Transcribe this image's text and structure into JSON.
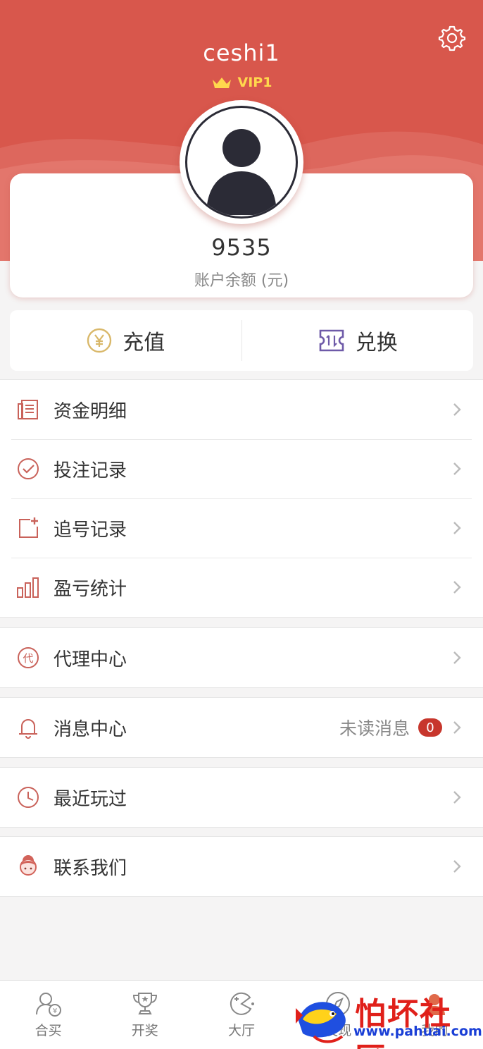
{
  "profile": {
    "username": "ceshi1",
    "vip_level": "VIP1",
    "balance": "9535",
    "balance_label": "账户余额 (元)"
  },
  "actions": {
    "recharge": "充值",
    "exchange": "兑换"
  },
  "menu": {
    "group1": [
      {
        "label": "资金明细",
        "icon": "document-list-icon"
      },
      {
        "label": "投注记录",
        "icon": "check-circle-icon"
      },
      {
        "label": "追号记录",
        "icon": "add-square-icon"
      },
      {
        "label": "盈亏统计",
        "icon": "bar-chart-icon"
      }
    ],
    "agent": {
      "label": "代理中心",
      "icon_text": "代"
    },
    "messages": {
      "label": "消息中心",
      "extra": "未读消息",
      "badge": "0"
    },
    "recent": {
      "label": "最近玩过"
    },
    "contact": {
      "label": "联系我们"
    }
  },
  "tabbar": [
    {
      "label": "合买",
      "icon": "group-buy-icon"
    },
    {
      "label": "开奖",
      "icon": "trophy-icon"
    },
    {
      "label": "大厅",
      "icon": "lobby-icon"
    },
    {
      "label": "发现",
      "icon": "compass-icon"
    },
    {
      "label": "我的",
      "icon": "user-icon"
    }
  ],
  "watermark": {
    "text": "怕坏社区",
    "url": "www.pahuai.com"
  },
  "colors": {
    "brand": "#d8574c",
    "vip_gold": "#ffd84d",
    "badge": "#c7362c",
    "icon_red": "#c9625a"
  }
}
